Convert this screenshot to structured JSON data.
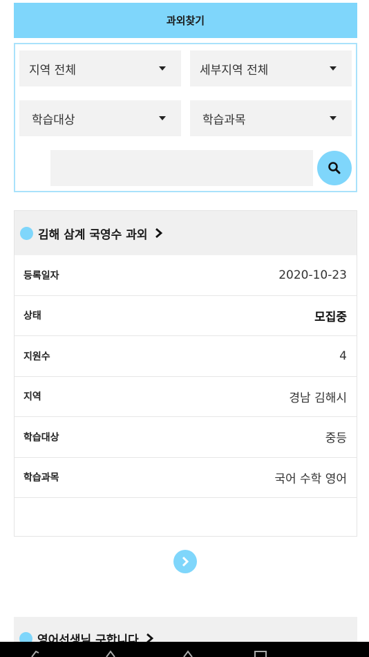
{
  "header": {
    "title": "과외찾기"
  },
  "filters": {
    "region": "지역 전체",
    "subregion": "세부지역 전체",
    "target": "학습대상",
    "subject": "학습과목",
    "search_value": ""
  },
  "listing": {
    "title": "김해 삼계 국영수 과외",
    "rows": [
      {
        "label": "등록일자",
        "value": "2020-10-23"
      },
      {
        "label": "상태",
        "value": "모집중"
      },
      {
        "label": "지원수",
        "value": "4"
      },
      {
        "label": "지역",
        "value": "경남 김해시"
      },
      {
        "label": "학습대상",
        "value": "중등"
      },
      {
        "label": "학습과목",
        "value": "국어 수학 영어"
      }
    ]
  },
  "listing2": {
    "title": "영어선생님 구합니다"
  },
  "colors": {
    "accent": "#7fd6fb",
    "header_bg": "#f0f0f0"
  }
}
